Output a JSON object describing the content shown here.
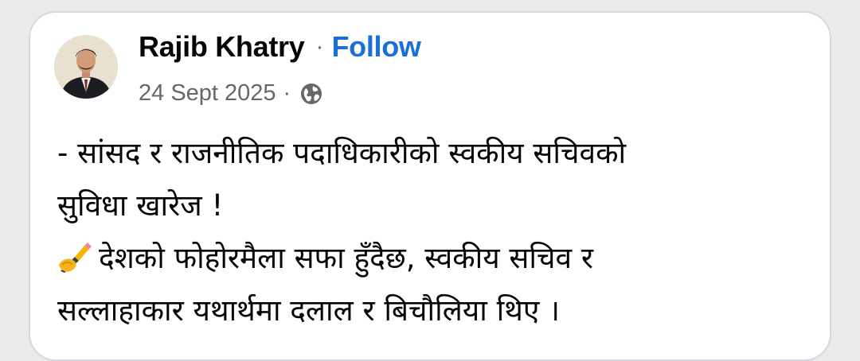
{
  "author": {
    "name": "Rajib Khatry",
    "separator": "·",
    "follow_label": "Follow"
  },
  "meta": {
    "date": "24 Sept 2025",
    "separator": "·",
    "privacy_icon": "globe-icon"
  },
  "post": {
    "lines": [
      "- सांसद र राजनीतिक पदाधिकारीको स्वकीय सचिवको",
      "सुविधा खारेज !",
      "देशको फोहोरमैला सफा हुँदैछ, स्वकीय सचिव र",
      "सल्लाहाकार यथार्थमा दलाल र बिचौलिया थिए ।"
    ],
    "emoji": "writing-hand-icon"
  },
  "colors": {
    "follow": "#1b6fd8",
    "meta": "#65676b",
    "text": "#050505"
  }
}
